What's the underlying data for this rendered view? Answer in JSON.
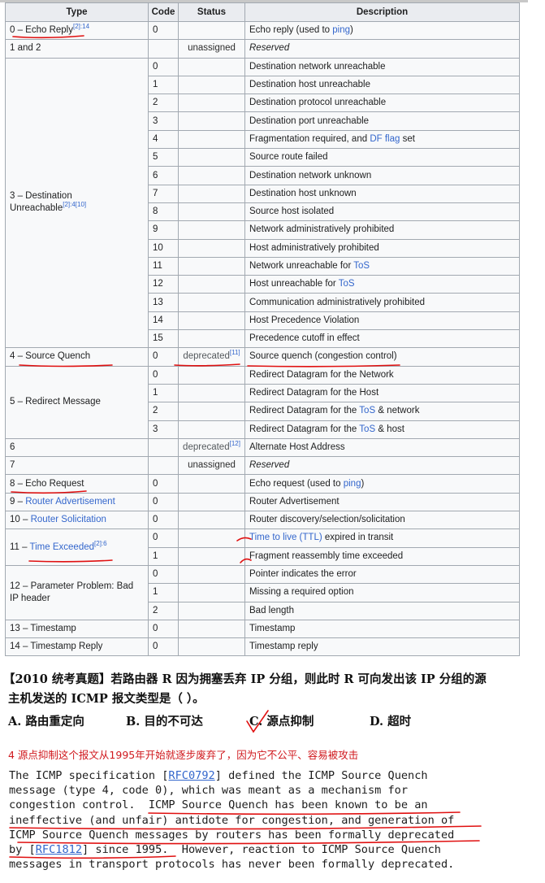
{
  "table": {
    "headers": [
      "Type",
      "Code",
      "Status",
      "Description"
    ],
    "groups": [
      {
        "type": "0 – Echo Reply",
        "type_link": false,
        "sup": "[2]:14",
        "rows": [
          {
            "code": "0",
            "status": "",
            "desc": [
              "Echo reply (used to ",
              "ping",
              ")"
            ]
          }
        ]
      },
      {
        "type": "1 and 2",
        "type_link": false,
        "sup": "",
        "rows": [
          {
            "code": "",
            "status": "unassigned",
            "desc": [
              "Reserved"
            ],
            "reserved": true
          }
        ]
      },
      {
        "type": "3 – Destination Unreachable",
        "type_link": false,
        "sup": "[2]:4[10]",
        "rows": [
          {
            "code": "0",
            "status": "",
            "desc": [
              "Destination network unreachable"
            ]
          },
          {
            "code": "1",
            "status": "",
            "desc": [
              "Destination host unreachable"
            ]
          },
          {
            "code": "2",
            "status": "",
            "desc": [
              "Destination protocol unreachable"
            ]
          },
          {
            "code": "3",
            "status": "",
            "desc": [
              "Destination port unreachable"
            ]
          },
          {
            "code": "4",
            "status": "",
            "desc": [
              "Fragmentation required, and ",
              "DF flag",
              " set"
            ]
          },
          {
            "code": "5",
            "status": "",
            "desc": [
              "Source route failed"
            ]
          },
          {
            "code": "6",
            "status": "",
            "desc": [
              "Destination network unknown"
            ]
          },
          {
            "code": "7",
            "status": "",
            "desc": [
              "Destination host unknown"
            ]
          },
          {
            "code": "8",
            "status": "",
            "desc": [
              "Source host isolated"
            ]
          },
          {
            "code": "9",
            "status": "",
            "desc": [
              "Network administratively prohibited"
            ]
          },
          {
            "code": "10",
            "status": "",
            "desc": [
              "Host administratively prohibited"
            ]
          },
          {
            "code": "11",
            "status": "",
            "desc": [
              "Network unreachable for ",
              "ToS"
            ]
          },
          {
            "code": "12",
            "status": "",
            "desc": [
              "Host unreachable for ",
              "ToS"
            ]
          },
          {
            "code": "13",
            "status": "",
            "desc": [
              "Communication administratively prohibited"
            ]
          },
          {
            "code": "14",
            "status": "",
            "desc": [
              "Host Precedence Violation"
            ]
          },
          {
            "code": "15",
            "status": "",
            "desc": [
              "Precedence cutoff in effect"
            ]
          }
        ]
      },
      {
        "type": "4 – Source Quench",
        "type_link": false,
        "sup": "",
        "rows": [
          {
            "code": "0",
            "status": "deprecated",
            "status_sup": "[11]",
            "desc": [
              "Source quench (congestion control)"
            ]
          }
        ]
      },
      {
        "type": "5 – Redirect Message",
        "type_link": false,
        "sup": "",
        "rows": [
          {
            "code": "0",
            "status": "",
            "desc": [
              "Redirect Datagram for the Network"
            ]
          },
          {
            "code": "1",
            "status": "",
            "desc": [
              "Redirect Datagram for the Host"
            ]
          },
          {
            "code": "2",
            "status": "",
            "desc": [
              "Redirect Datagram for the ",
              "ToS",
              " & network"
            ]
          },
          {
            "code": "3",
            "status": "",
            "desc": [
              "Redirect Datagram for the ",
              "ToS",
              " & host"
            ]
          }
        ]
      },
      {
        "type": "6",
        "type_link": false,
        "sup": "",
        "rows": [
          {
            "code": "",
            "status": "deprecated",
            "status_sup": "[12]",
            "desc": [
              "Alternate Host Address"
            ]
          }
        ]
      },
      {
        "type": "7",
        "type_link": false,
        "sup": "",
        "rows": [
          {
            "code": "",
            "status": "unassigned",
            "desc": [
              "Reserved"
            ],
            "reserved": true
          }
        ]
      },
      {
        "type": "8 – Echo Request",
        "type_link": false,
        "sup": "",
        "rows": [
          {
            "code": "0",
            "status": "",
            "desc": [
              "Echo request (used to ",
              "ping",
              ")"
            ]
          }
        ]
      },
      {
        "type_prefix": "9 – ",
        "type": "Router Advertisement",
        "type_link": true,
        "sup": "",
        "rows": [
          {
            "code": "0",
            "status": "",
            "desc": [
              "Router Advertisement"
            ]
          }
        ]
      },
      {
        "type_prefix": "10 – ",
        "type": "Router Solicitation",
        "type_link": true,
        "sup": "",
        "rows": [
          {
            "code": "0",
            "status": "",
            "desc": [
              "Router discovery/selection/solicitation"
            ]
          }
        ]
      },
      {
        "type_prefix": "11 – ",
        "type": "Time Exceeded",
        "type_link": true,
        "sup": "[2]:6",
        "rows": [
          {
            "code": "0",
            "status": "",
            "desc": [
              "",
              "Time to live (TTL)",
              " expired in transit"
            ]
          },
          {
            "code": "1",
            "status": "",
            "desc": [
              "Fragment reassembly time exceeded"
            ]
          }
        ]
      },
      {
        "type": "12 – Parameter Problem: Bad IP header",
        "type_link": false,
        "sup": "",
        "rows": [
          {
            "code": "0",
            "status": "",
            "desc": [
              "Pointer indicates the error"
            ]
          },
          {
            "code": "1",
            "status": "",
            "desc": [
              "Missing a required option"
            ]
          },
          {
            "code": "2",
            "status": "",
            "desc": [
              "Bad length"
            ]
          }
        ]
      },
      {
        "type": "13 – Timestamp",
        "type_link": false,
        "sup": "",
        "rows": [
          {
            "code": "0",
            "status": "",
            "desc": [
              "Timestamp"
            ]
          }
        ]
      },
      {
        "type": "14 – Timestamp Reply",
        "type_link": false,
        "sup": "",
        "rows": [
          {
            "code": "0",
            "status": "",
            "desc": [
              "Timestamp reply"
            ]
          }
        ]
      }
    ]
  },
  "question": {
    "line1": "【2010 统考真题】若路由器 R 因为拥塞丢弃 IP 分组，则此时 R 可向发出该 IP 分组的源",
    "line2": "主机发送的 ICMP 报文类型是（    ）。",
    "choices": [
      "A.  路由重定向",
      "B.  目的不可达",
      "C.  源点抑制",
      "D.  超时"
    ]
  },
  "note": "4 源点抑制这个报文从1995年开始就逐步废弃了，因为它不公平、容易被攻击",
  "rfc": {
    "lines": [
      [
        "The ICMP specification [",
        "RFC0792",
        "] defined the ICMP Source Quench"
      ],
      [
        "message (type 4, code 0), which was meant as a mechanism for"
      ],
      [
        "congestion control.  ICMP Source Quench has been known to be an"
      ],
      [
        "ineffective (and unfair) antidote for congestion, and generation of"
      ],
      [
        "ICMP Source Quench messages by routers has been formally deprecated"
      ],
      [
        "by [",
        "RFC1812",
        "] since 1995.  However, reaction to ICMP Source Quench"
      ],
      [
        "messages in transport protocols has never been formally deprecated."
      ]
    ]
  },
  "colors": {
    "link": "#3366cc",
    "annotation": "#e01010",
    "header_bg": "#eaecf0",
    "cell_bg": "#f8f9fa",
    "border": "#a2a9b1"
  }
}
